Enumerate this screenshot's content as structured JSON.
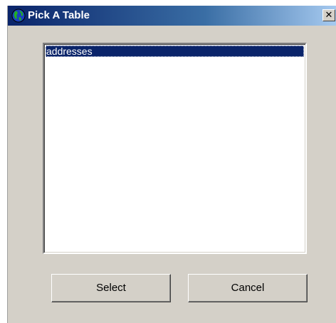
{
  "window": {
    "title": "Pick A Table",
    "close_glyph": "✕",
    "icon": "globe-icon"
  },
  "list": {
    "items": [
      {
        "label": "addresses",
        "selected": true
      }
    ]
  },
  "buttons": {
    "select_label": "Select",
    "cancel_label": "Cancel"
  },
  "colors": {
    "titlebar_start": "#0a246a",
    "titlebar_end": "#a6caf0",
    "selection": "#0a246a",
    "face": "#d4d0c8"
  }
}
